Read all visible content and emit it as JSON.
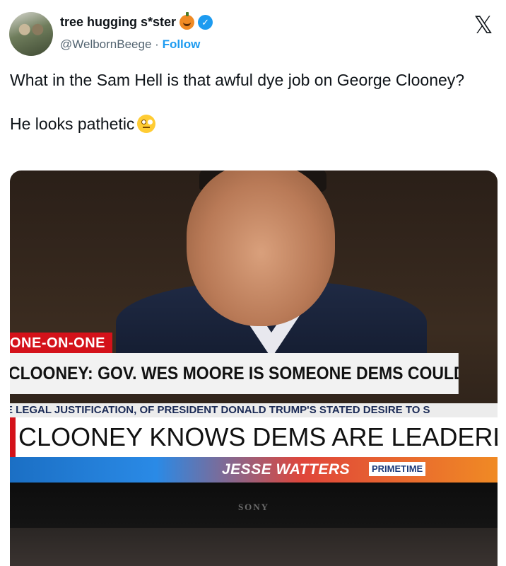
{
  "tweet": {
    "display_name": "tree hugging s*ster",
    "handle": "@WelbornBeege",
    "separator": "·",
    "follow_label": "Follow",
    "text_line1": "What in the Sam Hell is that awful dye job on George Clooney?",
    "text_line2": "He looks pathetic",
    "emoji_name": "face-with-rolling-eyes",
    "verified_icon": "verified-badge",
    "name_emoji": "jack-o-lantern"
  },
  "x_logo_glyph": "𝕏",
  "media": {
    "chyron_tag": "ONE-ON-ONE",
    "chyron_top": "CLOONEY: GOV. WES MOORE IS SOMEONE DEMS COULD \"JOIN IN BEHIND",
    "ticker": "E LEGAL JUSTIFICATION, OF PRESIDENT DONALD TRUMP'S STATED DESIRE TO S",
    "chyron_main": "CLOONEY KNOWS DEMS ARE LEADERL",
    "show_name": "JESSE WATTERS",
    "show_badge": "PRIMETIME",
    "tv_brand": "SONY"
  },
  "colors": {
    "link": "#1d9bf0",
    "text": "#0f1419",
    "secondary": "#536471",
    "chyron_red": "#d4121a"
  }
}
